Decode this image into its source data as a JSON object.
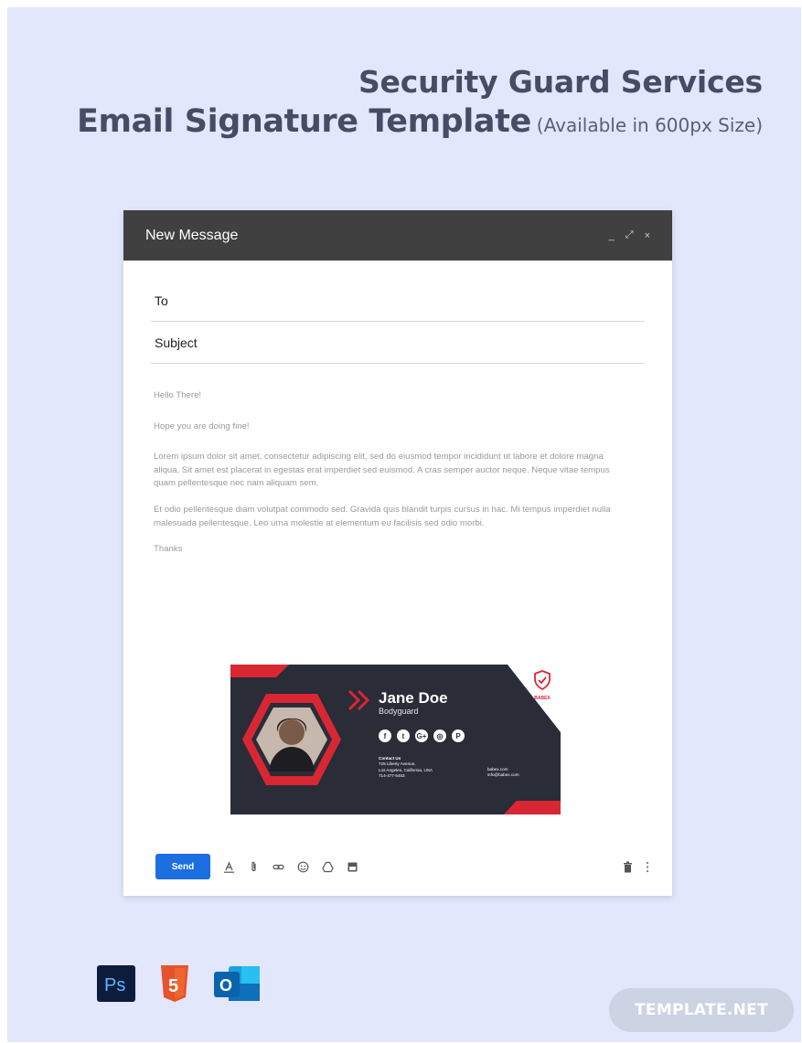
{
  "heading": {
    "line1": "Security Guard Services",
    "line2": "Email Signature Template",
    "availability": "(Available in 600px Size)"
  },
  "compose": {
    "title": "New Message",
    "window_controls": [
      "_",
      "⤢",
      "×"
    ],
    "to_label": "To",
    "subject_label": "Subject",
    "greeting": "Hello There!",
    "opening": "Hope you are doing fine!",
    "paragraph1": "Lorem ipsum dolor sit amet, consectetur adipiscing elit, sed do eiusmod tempor incididunt ut labore et dolore magna aliqua. Sit amet est placerat in egestas erat imperdiet sed euismod. A cras semper auctor neque. Neque vitae tempus quam pellentesque nec nam aliquam sem.",
    "paragraph2": " Et odio pellentesque diam volutpat commodo sed. Gravida quis blandit turpis cursus in hac. Mi tempus imperdiet nulla malesuada pellentesque. Leo urna molestie at elementum eu facilisis sed odio morbi.",
    "closing": "Thanks",
    "send_label": "Send"
  },
  "signature": {
    "name": "Jane Doe",
    "role": "Bodyguard",
    "badge_text": "BABEX",
    "socials": [
      "f",
      "t",
      "G+",
      "◎",
      "P"
    ],
    "contact_heading": "Contact Us",
    "address_line1": "725 Liberty Avenue,",
    "address_line2": "Los Angeles, California, USA",
    "phone": "714-477-5463",
    "website": "babex.com",
    "email": "info@babex.com"
  },
  "footer": {
    "apps": [
      "Ps",
      "5",
      "O"
    ],
    "brand": "TEMPLATE.NET"
  },
  "colors": {
    "background": "#e2e7fb",
    "heading": "#474c66",
    "titlebar": "#404040",
    "send_button": "#1b6fe0",
    "signature_bg": "#2a2c38",
    "signature_accent": "#d82733"
  },
  "icons": {
    "toolbar": [
      "format-text-icon",
      "attach-icon",
      "link-icon",
      "emoji-icon",
      "drive-icon",
      "photo-icon"
    ],
    "toolbar_right": [
      "trash-icon",
      "more-vert-icon"
    ]
  }
}
